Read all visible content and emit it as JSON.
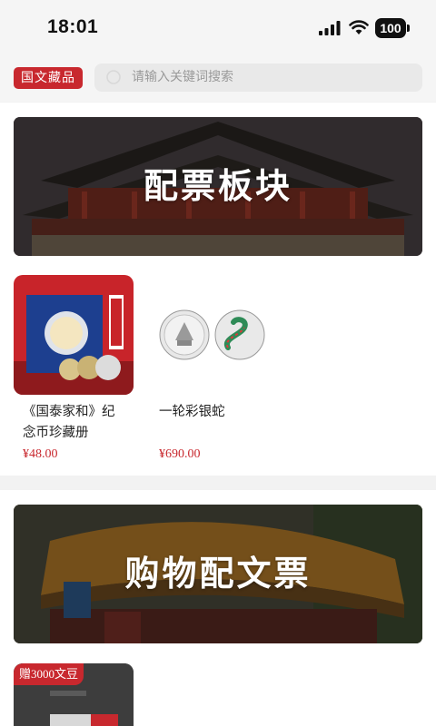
{
  "status_bar": {
    "time": "18:01",
    "battery": "100"
  },
  "header": {
    "brand": "国文藏品",
    "search_placeholder": "请输入关键词搜索"
  },
  "sections": [
    {
      "banner_title": "配票板块",
      "products": [
        {
          "name": "《国泰家和》纪念币珍藏册",
          "price": "¥48.00"
        },
        {
          "name": "一轮彩银蛇",
          "price": "¥690.00"
        }
      ]
    },
    {
      "banner_title": "购物配文票",
      "products": [
        {
          "badge": "赠3000文豆"
        }
      ]
    }
  ],
  "colors": {
    "accent": "#c8282e",
    "background": "#f2f2f2",
    "card": "#ffffff"
  }
}
